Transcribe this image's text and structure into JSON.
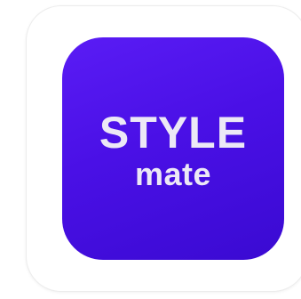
{
  "app_icon": {
    "logo_word_top": "STYLE",
    "logo_word_bottom": "mate",
    "background_color": "#4a10e6",
    "text_color": "#ece8f6"
  }
}
